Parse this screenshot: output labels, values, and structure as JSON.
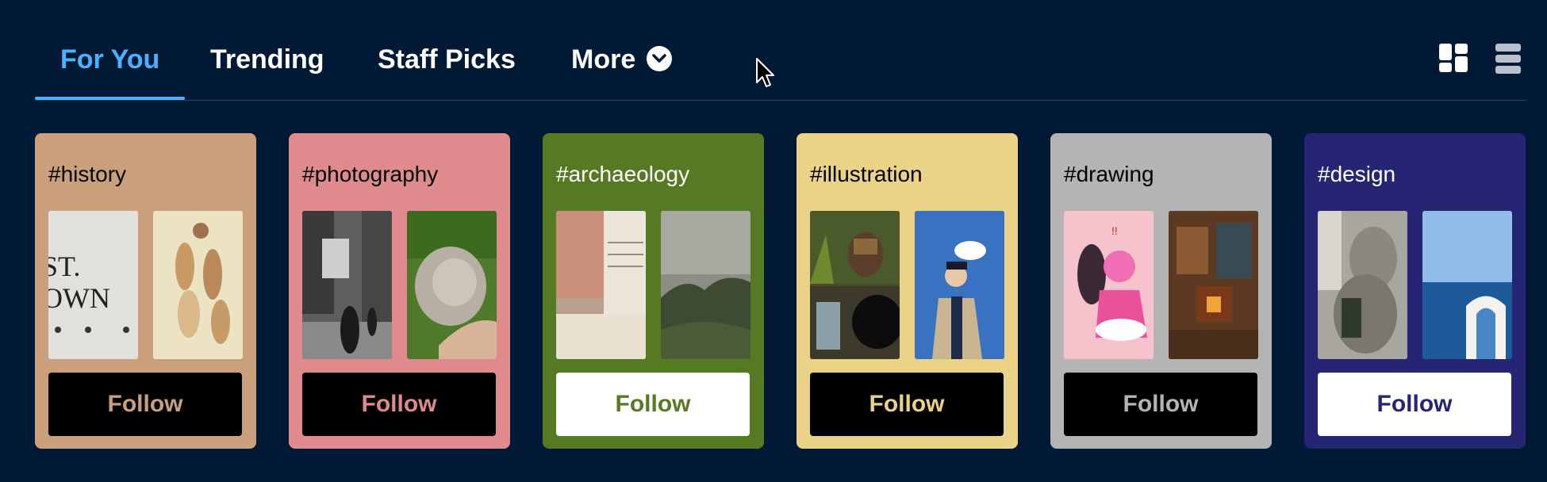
{
  "tabs": [
    {
      "label": "For You",
      "active": true
    },
    {
      "label": "Trending",
      "active": false
    },
    {
      "label": "Staff Picks",
      "active": false
    },
    {
      "label": "More",
      "active": false
    }
  ],
  "view_controls": [
    "grid-view-icon",
    "list-view-icon"
  ],
  "colors": {
    "background": "#001935",
    "accent": "#4db0ff"
  },
  "cards": [
    {
      "tag": "#history",
      "button": "Follow",
      "bg": "#c9a07b",
      "button_bg": "#000000",
      "button_fg": "#c9a07b"
    },
    {
      "tag": "#photography",
      "button": "Follow",
      "bg": "#df8a8d",
      "button_bg": "#000000",
      "button_fg": "#df8a8d"
    },
    {
      "tag": "#archaeology",
      "button": "Follow",
      "bg": "#567a24",
      "button_bg": "#ffffff",
      "button_fg": "#567a24"
    },
    {
      "tag": "#illustration",
      "button": "Follow",
      "bg": "#ead386",
      "button_bg": "#000000",
      "button_fg": "#ead386"
    },
    {
      "tag": "#drawing",
      "button": "Follow",
      "bg": "#b4b4b4",
      "button_bg": "#000000",
      "button_fg": "#b4b4b4"
    },
    {
      "tag": "#design",
      "button": "Follow",
      "bg": "#262574",
      "button_bg": "#ffffff",
      "button_fg": "#262574"
    }
  ]
}
